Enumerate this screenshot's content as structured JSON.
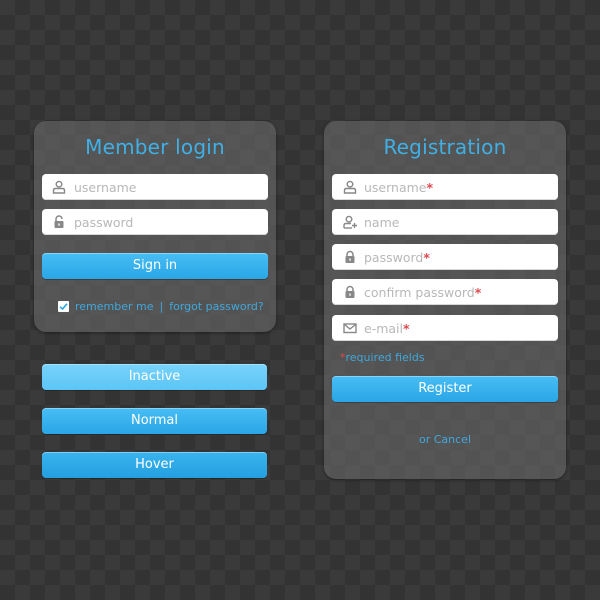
{
  "login": {
    "title": "Member login",
    "username_placeholder": "username",
    "password_placeholder": "password",
    "sign_in_label": "Sign in",
    "remember_label": "remember me",
    "remember_checked": true,
    "separator": "|",
    "forgot_label": "forgot password?"
  },
  "button_states": {
    "inactive_label": "Inactive",
    "normal_label": "Normal",
    "hover_label": "Hover"
  },
  "registration": {
    "title": "Registration",
    "fields": [
      {
        "placeholder": "username",
        "required": true,
        "icon": "user-icon"
      },
      {
        "placeholder": "name",
        "required": false,
        "icon": "add-user-icon"
      },
      {
        "placeholder": "password",
        "required": true,
        "icon": "lock-icon"
      },
      {
        "placeholder": "confirm password",
        "required": true,
        "icon": "lock-icon"
      },
      {
        "placeholder": "e-mail",
        "required": true,
        "icon": "mail-icon"
      }
    ],
    "required_star": "*",
    "required_note": "required fields",
    "register_label": "Register",
    "cancel_label": "or Cancel"
  },
  "colors": {
    "accent": "#3fb0e6",
    "button": "#2aa6e6",
    "required": "#e0484f"
  }
}
